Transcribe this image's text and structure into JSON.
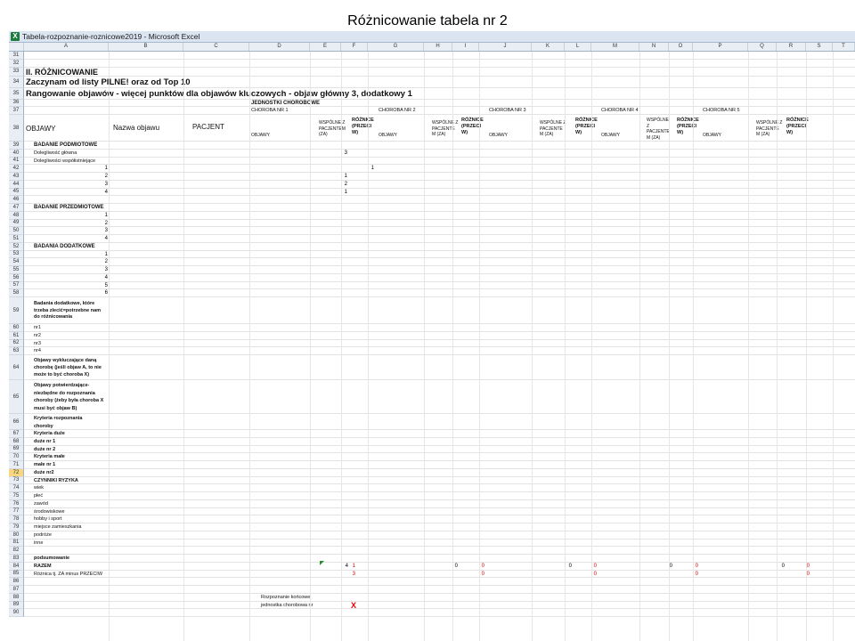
{
  "slide": {
    "title": "Różnicowanie tabela nr 2"
  },
  "window": {
    "title": "Tabela-rozpoznanie-roznicowe2019 - Microsoft Excel",
    "app_icon": "excel-icon"
  },
  "columns": [
    "A",
    "B",
    "C",
    "D",
    "E",
    "F",
    "G",
    "H",
    "I",
    "J",
    "K",
    "L",
    "M",
    "N",
    "O",
    "P",
    "Q",
    "R",
    "S",
    "T"
  ],
  "headings": {
    "section": "II. RÓŻNICOWANIE",
    "start": "Zaczynam od listy PILNE! oraz od Top 10",
    "ranking": "Rangowanie objawów - więcej punktów dla objawów kluczowych - objaw główny 3, dodatkowy 1",
    "units": "JEDNOSTKI CHOROBOWE"
  },
  "diseases": [
    "CHOROBA NR 1",
    "CHOROBA NR 2",
    "CHOROBA NR 3",
    "CHOROBA NR 4",
    "CHOROBA NR 5"
  ],
  "header_row": {
    "objawy": "OBJAWY",
    "nazwa": "Nazwa objawu",
    "pacjent": "PACJENT",
    "sub_objawy": "OBJAWY",
    "wspolne": [
      "WSPÓLNE Z",
      "PACJENTEM",
      "(ZA)"
    ],
    "wspolne_variant": [
      "WSPÓLNE Z",
      "PACJENTE",
      "M (ZA)"
    ],
    "wspolne_n4": [
      "WSPÓLNE",
      "Z",
      "PACJENTE",
      "M (ZA)"
    ],
    "roznice": [
      "RÓŻNICE",
      "(PRZECI",
      "W)"
    ]
  },
  "labels": {
    "r39": "BADANIE PODMIOTOWE",
    "r40": "Dolegliwość główna",
    "r41": "Dolegliwości  współistniejące",
    "r47": "BADANIE PRZEDMIOTOWE",
    "r52": "BADANIA DODATKOWE",
    "r59": [
      "Badania dodatkowe, które",
      "trzeba zlecić=potrzebne nam",
      "do różnicowania"
    ],
    "r60": "nr1",
    "r61": "nr2",
    "r62": "nr3",
    "r63": "nr4",
    "r64": [
      "Objawy wykluczające daną",
      "chorobę (jeśli objaw A, to nie",
      "może to być choroba X)"
    ],
    "r65": [
      "Objawy potwierdzające-",
      "niezbędne do rozpoznania",
      "choroby (żeby była choroba X",
      "musi być objaw B)"
    ],
    "r66": [
      "Kryteria rozpoznania",
      "choroby"
    ],
    "r67": "Kryteria duże",
    "r68": "duże nr 1",
    "r69": "duże nr 2",
    "r70": "Kryteria małe",
    "r71": "małe nr 1",
    "r72": "duże nr2",
    "r73": "CZYNNIKI RYZYKA",
    "r74": "wiek",
    "r75": "płeć",
    "r76": "zawód",
    "r77": "środowiskowe",
    "r78": "hobby i sport",
    "r79": "miejsce zamieszkania",
    "r80": "podróże",
    "r81": "inne",
    "r83": "podsumowanie",
    "r84": "RAZEM",
    "r85": "Różnica tj. ZA minus PRZECIW",
    "r88": "Rozpoznanie końcowe",
    "r89": "jednostka chorobowa nr",
    "r89_mark": "X"
  },
  "numbers": {
    "r40_e": "3",
    "r42_a": "1",
    "r42_f": "1",
    "r43_a": "2",
    "r43_e": "1",
    "r44_a": "3",
    "r44_e": "2",
    "r45_a": "4",
    "r45_e": "1",
    "r48": "1",
    "r49": "2",
    "r50": "3",
    "r51": "4",
    "r53": "1",
    "r54": "2",
    "r55": "3",
    "r56": "4",
    "r57": "5",
    "r58": "6",
    "r84": [
      "4",
      "1",
      "0",
      "0",
      "0",
      "0",
      "0",
      "0",
      "0",
      "0"
    ],
    "r85": [
      "3",
      "0",
      "0",
      "0",
      "0"
    ]
  },
  "colors": {
    "red": "#e00000",
    "highlight_row": "#f9d77e",
    "header_bg": "#e9eef5"
  }
}
